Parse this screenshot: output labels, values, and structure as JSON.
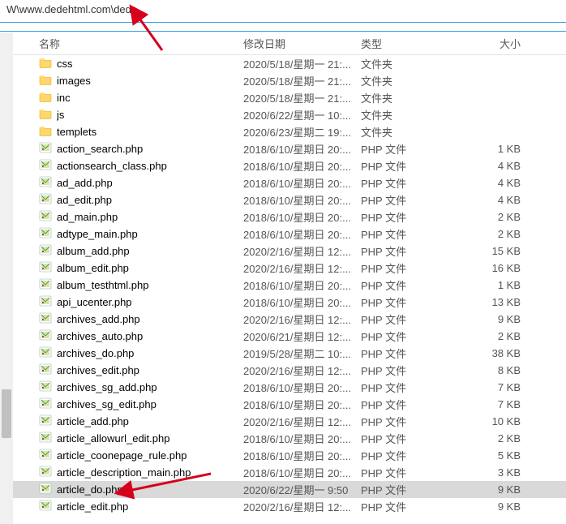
{
  "address_bar": "W\\www.dedehtml.com\\dede",
  "columns": {
    "name": "名称",
    "date": "修改日期",
    "type": "类型",
    "size": "大小"
  },
  "folder_type": "文件夹",
  "php_type": "PHP 文件",
  "rows": [
    {
      "kind": "folder",
      "name": "css",
      "date": "2020/5/18/星期一 21:...",
      "type": "文件夹",
      "size": ""
    },
    {
      "kind": "folder",
      "name": "images",
      "date": "2020/5/18/星期一 21:...",
      "type": "文件夹",
      "size": ""
    },
    {
      "kind": "folder",
      "name": "inc",
      "date": "2020/5/18/星期一 21:...",
      "type": "文件夹",
      "size": ""
    },
    {
      "kind": "folder",
      "name": "js",
      "date": "2020/6/22/星期一 10:...",
      "type": "文件夹",
      "size": ""
    },
    {
      "kind": "folder",
      "name": "templets",
      "date": "2020/6/23/星期二 19:...",
      "type": "文件夹",
      "size": ""
    },
    {
      "kind": "php",
      "name": "action_search.php",
      "date": "2018/6/10/星期日 20:...",
      "type": "PHP 文件",
      "size": "1 KB"
    },
    {
      "kind": "php",
      "name": "actionsearch_class.php",
      "date": "2018/6/10/星期日 20:...",
      "type": "PHP 文件",
      "size": "4 KB"
    },
    {
      "kind": "php",
      "name": "ad_add.php",
      "date": "2018/6/10/星期日 20:...",
      "type": "PHP 文件",
      "size": "4 KB"
    },
    {
      "kind": "php",
      "name": "ad_edit.php",
      "date": "2018/6/10/星期日 20:...",
      "type": "PHP 文件",
      "size": "4 KB"
    },
    {
      "kind": "php",
      "name": "ad_main.php",
      "date": "2018/6/10/星期日 20:...",
      "type": "PHP 文件",
      "size": "2 KB"
    },
    {
      "kind": "php",
      "name": "adtype_main.php",
      "date": "2018/6/10/星期日 20:...",
      "type": "PHP 文件",
      "size": "2 KB"
    },
    {
      "kind": "php",
      "name": "album_add.php",
      "date": "2020/2/16/星期日 12:...",
      "type": "PHP 文件",
      "size": "15 KB"
    },
    {
      "kind": "php",
      "name": "album_edit.php",
      "date": "2020/2/16/星期日 12:...",
      "type": "PHP 文件",
      "size": "16 KB"
    },
    {
      "kind": "php",
      "name": "album_testhtml.php",
      "date": "2018/6/10/星期日 20:...",
      "type": "PHP 文件",
      "size": "1 KB"
    },
    {
      "kind": "php",
      "name": "api_ucenter.php",
      "date": "2018/6/10/星期日 20:...",
      "type": "PHP 文件",
      "size": "13 KB"
    },
    {
      "kind": "php",
      "name": "archives_add.php",
      "date": "2020/2/16/星期日 12:...",
      "type": "PHP 文件",
      "size": "9 KB"
    },
    {
      "kind": "php",
      "name": "archives_auto.php",
      "date": "2020/6/21/星期日 12:...",
      "type": "PHP 文件",
      "size": "2 KB"
    },
    {
      "kind": "php",
      "name": "archives_do.php",
      "date": "2019/5/28/星期二 10:...",
      "type": "PHP 文件",
      "size": "38 KB"
    },
    {
      "kind": "php",
      "name": "archives_edit.php",
      "date": "2020/2/16/星期日 12:...",
      "type": "PHP 文件",
      "size": "8 KB"
    },
    {
      "kind": "php",
      "name": "archives_sg_add.php",
      "date": "2018/6/10/星期日 20:...",
      "type": "PHP 文件",
      "size": "7 KB"
    },
    {
      "kind": "php",
      "name": "archives_sg_edit.php",
      "date": "2018/6/10/星期日 20:...",
      "type": "PHP 文件",
      "size": "7 KB"
    },
    {
      "kind": "php",
      "name": "article_add.php",
      "date": "2020/2/16/星期日 12:...",
      "type": "PHP 文件",
      "size": "10 KB"
    },
    {
      "kind": "php",
      "name": "article_allowurl_edit.php",
      "date": "2018/6/10/星期日 20:...",
      "type": "PHP 文件",
      "size": "2 KB"
    },
    {
      "kind": "php",
      "name": "article_coonepage_rule.php",
      "date": "2018/6/10/星期日 20:...",
      "type": "PHP 文件",
      "size": "5 KB"
    },
    {
      "kind": "php",
      "name": "article_description_main.php",
      "date": "2018/6/10/星期日 20:...",
      "type": "PHP 文件",
      "size": "3 KB"
    },
    {
      "kind": "php",
      "name": "article_do.php",
      "date": "2020/6/22/星期一 9:50",
      "type": "PHP 文件",
      "size": "9 KB",
      "selected": true
    },
    {
      "kind": "php",
      "name": "article_edit.php",
      "date": "2020/2/16/星期日 12:...",
      "type": "PHP 文件",
      "size": "9 KB"
    }
  ]
}
